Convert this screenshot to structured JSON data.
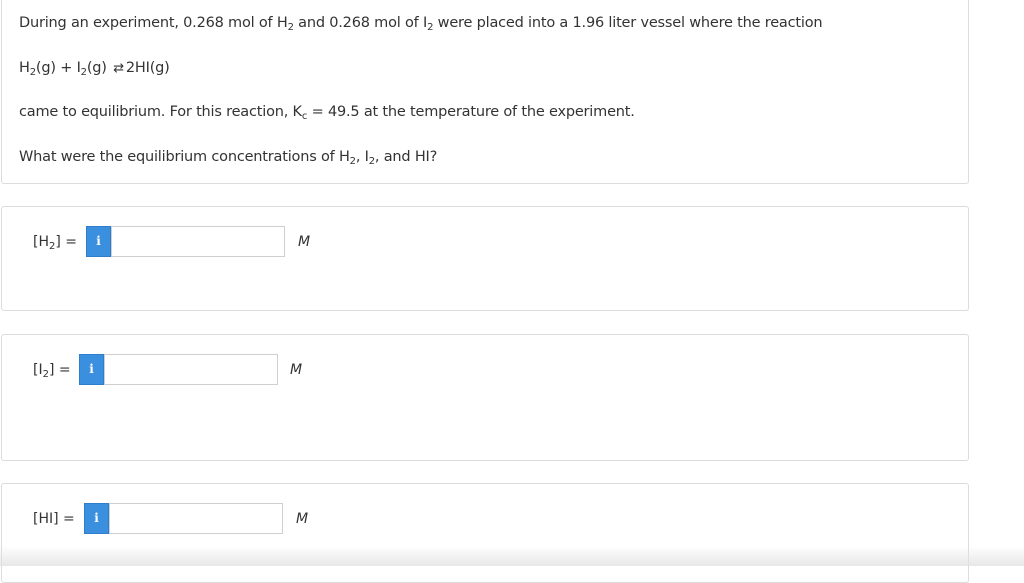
{
  "question": {
    "line1": {
      "part1": "During an experiment, 0.268 mol of H",
      "sub1": "2",
      "part2": " and 0.268 mol of I",
      "sub2": "2",
      "part3": " were placed into a 1.96 liter vessel where the reaction"
    },
    "equation": {
      "h2": "H",
      "h2_sub": "2",
      "h2_phase": "(g)",
      "plus": " + ",
      "i2": "I",
      "i2_sub": "2",
      "i2_phase": "(g)",
      "arrow": "⇄",
      "product": "2HI",
      "product_phase": "(g)"
    },
    "line3": {
      "part1": "came to equilibrium. For this reaction, K",
      "sub": "c",
      "part2": " = 49.5 at the temperature of the experiment."
    },
    "line4": {
      "part1": "What were the equilibrium concentrations of H",
      "sub1": "2",
      "part2": ", I",
      "sub2": "2",
      "part3": ", and HI?"
    }
  },
  "answers": {
    "h2": {
      "label_open": "[H",
      "label_sub": "2",
      "label_close": "] =",
      "value": "",
      "unit": "M"
    },
    "i2": {
      "label_open": "[I",
      "label_sub": "2",
      "label_close": "] =",
      "value": "",
      "unit": "M"
    },
    "hi": {
      "label": "[HI] =",
      "value": "",
      "unit": "M"
    }
  },
  "info_icon": "i",
  "colors": {
    "info_button": "#3b8fdf",
    "card_border": "#dcdcdc",
    "text": "#333333"
  }
}
